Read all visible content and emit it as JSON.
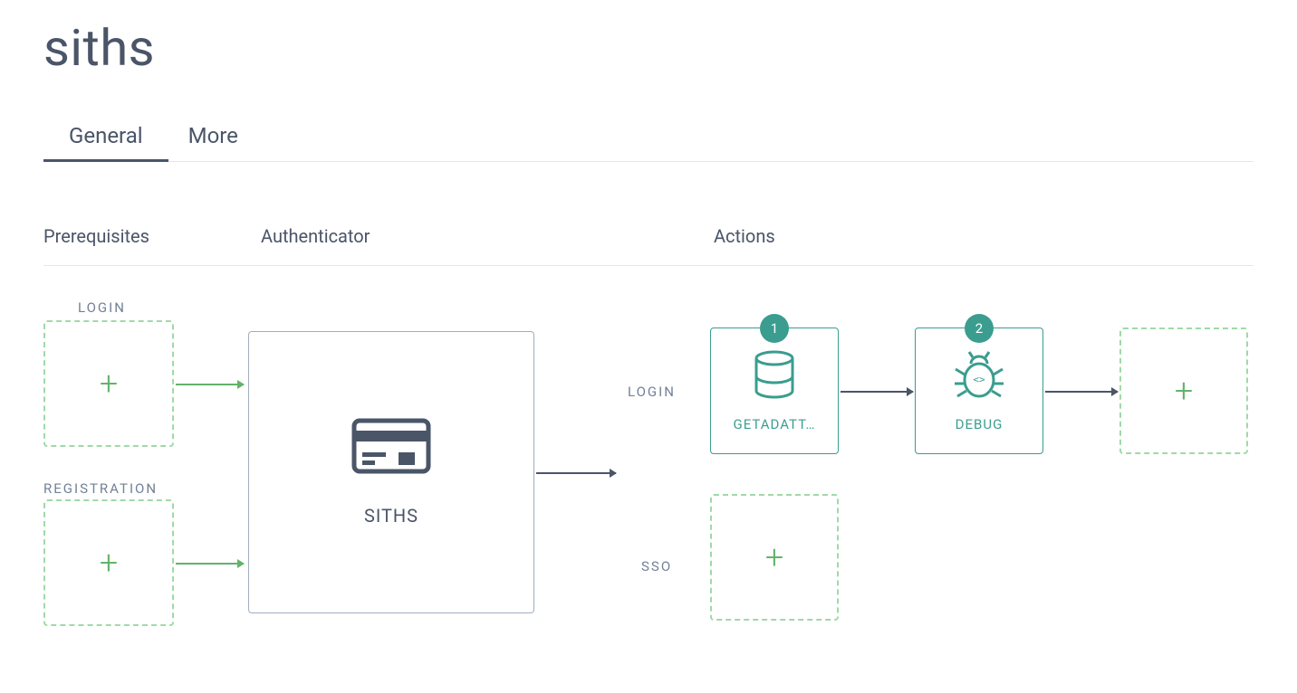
{
  "page_title": "siths",
  "tabs": {
    "general": "General",
    "more": "More",
    "active": "general"
  },
  "columns": {
    "prereq": "Prerequisites",
    "auth": "Authenticator",
    "actions": "Actions"
  },
  "prerequisites": {
    "login_label": "LOGIN",
    "registration_label": "REGISTRATION"
  },
  "authenticator": {
    "name": "SITHS",
    "icon": "card-icon"
  },
  "action_rows": {
    "login_label": "LOGIN",
    "sso_label": "SSO"
  },
  "actions": {
    "login": [
      {
        "order": "1",
        "label": "GETADATT…",
        "icon": "database-icon"
      },
      {
        "order": "2",
        "label": "DEBUG",
        "icon": "bug-icon"
      }
    ]
  },
  "colors": {
    "teal": "#3a9d8f",
    "green": "#62b36a",
    "slate": "#4a5568",
    "border": "#e2e8f0"
  }
}
